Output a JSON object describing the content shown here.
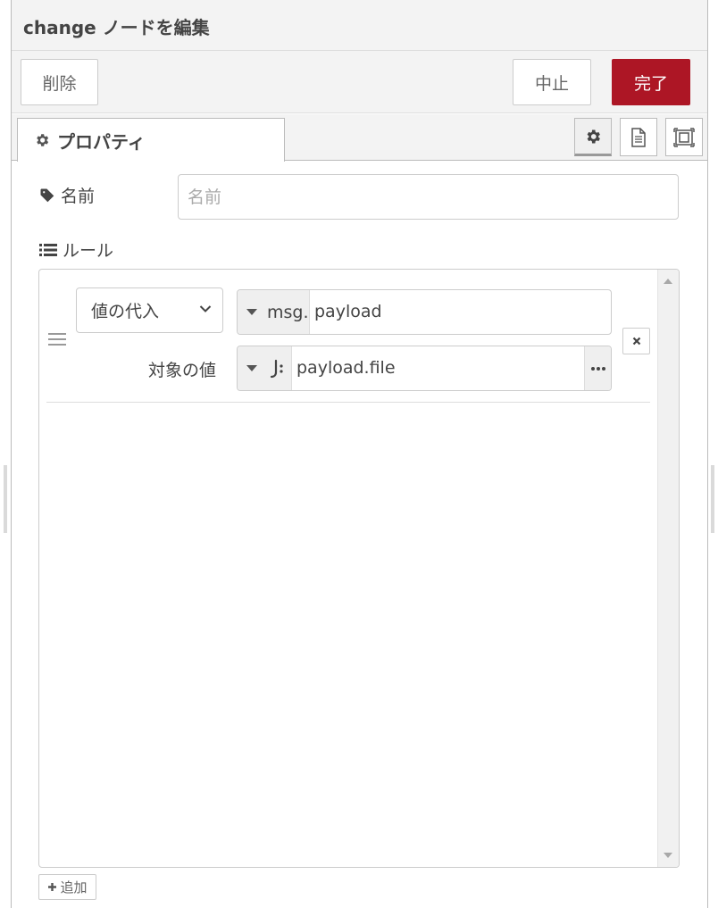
{
  "header": {
    "title": "change ノードを編集"
  },
  "toolbar": {
    "delete_label": "削除",
    "cancel_label": "中止",
    "done_label": "完了"
  },
  "tabs": {
    "properties_label": "プロパティ",
    "icons": [
      "gear-icon",
      "document-icon",
      "node-appearance-icon"
    ]
  },
  "form": {
    "name_label": "名前",
    "name_placeholder": "名前",
    "name_value": "",
    "rules_label": "ルール"
  },
  "rules": [
    {
      "action": "値の代入",
      "target_prefix": "msg.",
      "target_value": "payload",
      "value_label": "対象の値",
      "value_type_icon": "jsonata-icon",
      "value": "payload.file"
    }
  ],
  "add_label": "追加",
  "colors": {
    "primary": "#ad1625",
    "header_bg": "#f3f3f3",
    "border": "#cccccc"
  }
}
